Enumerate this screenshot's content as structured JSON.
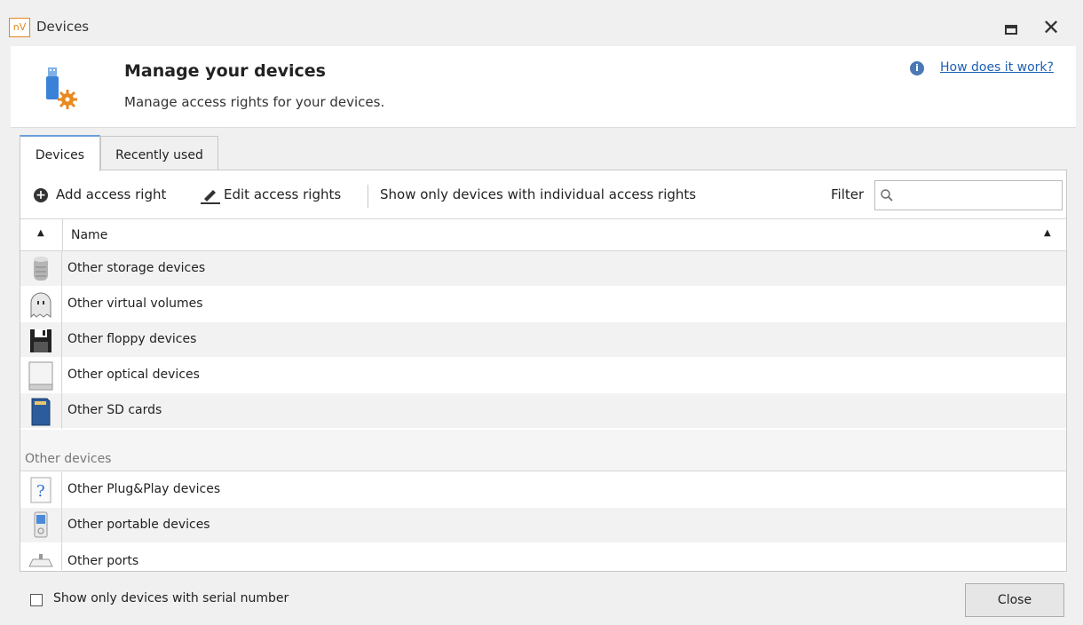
{
  "window": {
    "app_logo": "nV",
    "title": "Devices"
  },
  "header": {
    "title": "Manage your devices",
    "subtitle": "Manage access rights for your devices.",
    "help_link": "How does it work?"
  },
  "tabs": [
    {
      "label": "Devices",
      "active": true
    },
    {
      "label": "Recently used",
      "active": false
    }
  ],
  "toolbar": {
    "add_label": "Add access right",
    "edit_label": "Edit access rights",
    "show_only_label": "Show only devices with individual access rights",
    "filter_label": "Filter",
    "filter_value": ""
  },
  "grid": {
    "column_name": "Name",
    "rows": [
      {
        "label": "Other storage devices",
        "icon": "storage-icon"
      },
      {
        "label": "Other virtual volumes",
        "icon": "ghost-icon"
      },
      {
        "label": "Other floppy devices",
        "icon": "floppy-icon"
      },
      {
        "label": "Other optical devices",
        "icon": "optical-drive-icon"
      },
      {
        "label": "Other SD cards",
        "icon": "sd-card-icon"
      }
    ],
    "group_label": "Other devices",
    "group_rows": [
      {
        "label": "Other Plug&Play devices",
        "icon": "question-icon"
      },
      {
        "label": "Other portable devices",
        "icon": "portable-device-icon"
      },
      {
        "label": "Other ports",
        "icon": "port-icon"
      }
    ]
  },
  "footer": {
    "serial_checkbox_label": "Show only devices with serial number",
    "serial_checked": false,
    "close_label": "Close"
  },
  "colors": {
    "accent": "#1c5fb5",
    "row_alt": "#f2f2f2",
    "tab_active_border": "#6a9fd8"
  }
}
